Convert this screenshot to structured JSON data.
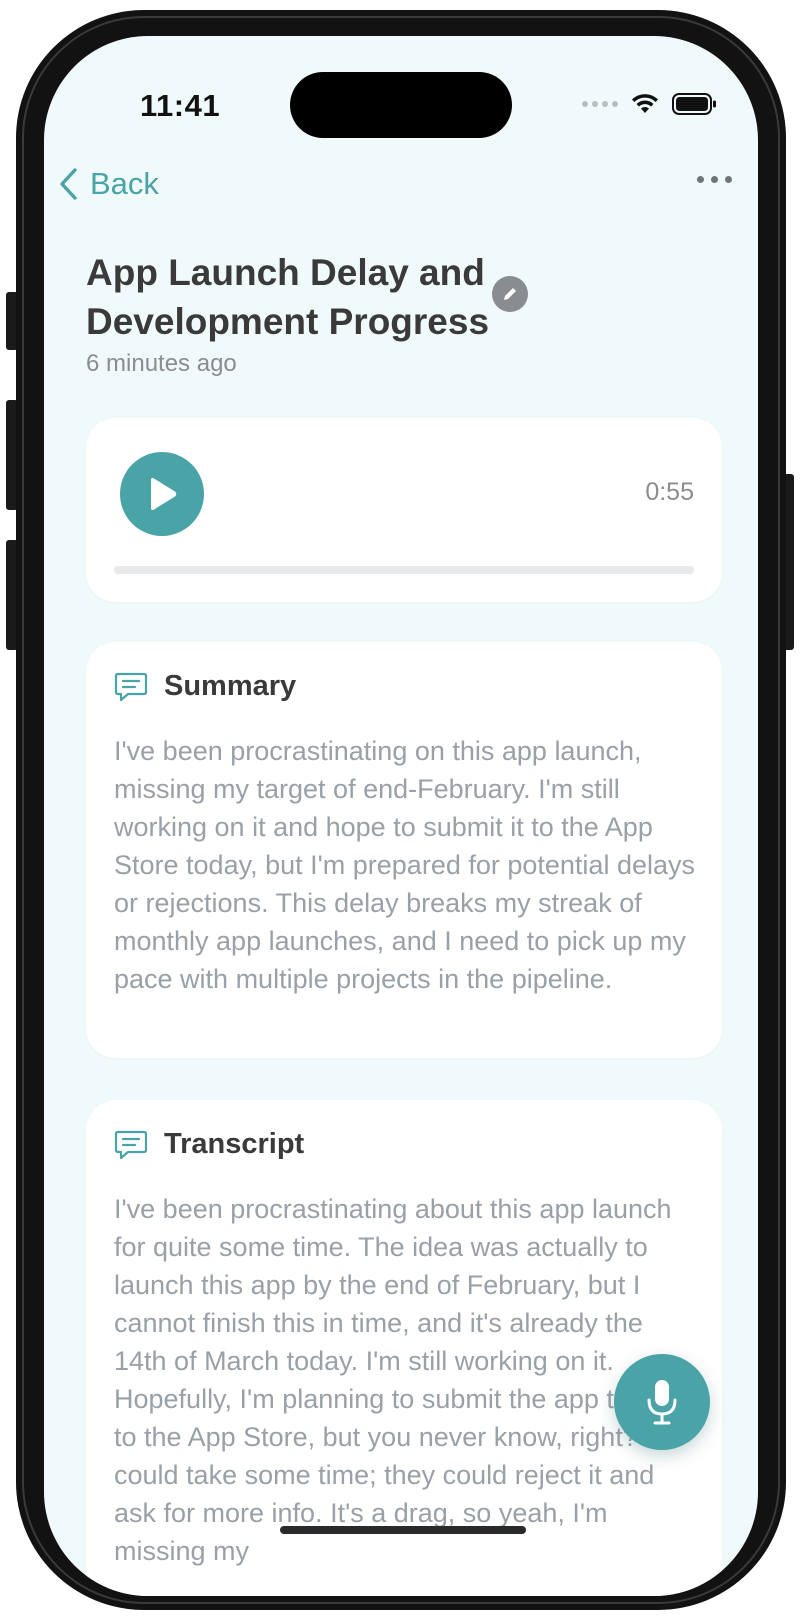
{
  "status_bar": {
    "time": "11:41"
  },
  "nav": {
    "back_label": "Back"
  },
  "note": {
    "title": "App Launch Delay and Development Progress",
    "timestamp": "6 minutes ago"
  },
  "player": {
    "duration": "0:55",
    "progress": 0
  },
  "summary": {
    "heading": "Summary",
    "text": "I've been procrastinating on this app launch, missing my target of end-February. I'm still working on it and hope to submit it to the App Store today, but I'm prepared for potential delays or rejections. This delay breaks my streak of monthly app launches, and I need to pick up my pace with multiple projects in the pipeline."
  },
  "transcript": {
    "heading": "Transcript",
    "text": "I've been procrastinating about this app launch for quite some time. The idea was actually to launch this app by the end of February, but I cannot finish this in time, and it's already the 14th of March today. I'm still working on it. Hopefully, I'm planning to submit the app today to the App Store, but you never know, right? It could take some time; they could reject it and ask for more info. It's a drag, so yeah, I'm missing my"
  },
  "icons": {
    "back": "chevron-left-icon",
    "more": "ellipsis-icon",
    "edit": "pencil-icon",
    "play": "play-icon",
    "section": "chat-bubble-icon",
    "mic": "microphone-icon"
  },
  "colors": {
    "accent": "#4aa3a6",
    "background": "#f1fafa",
    "card": "#ffffff",
    "title_text": "#3a3a3a",
    "body_text": "#9aa0a8",
    "muted_text": "#8a8d90"
  }
}
